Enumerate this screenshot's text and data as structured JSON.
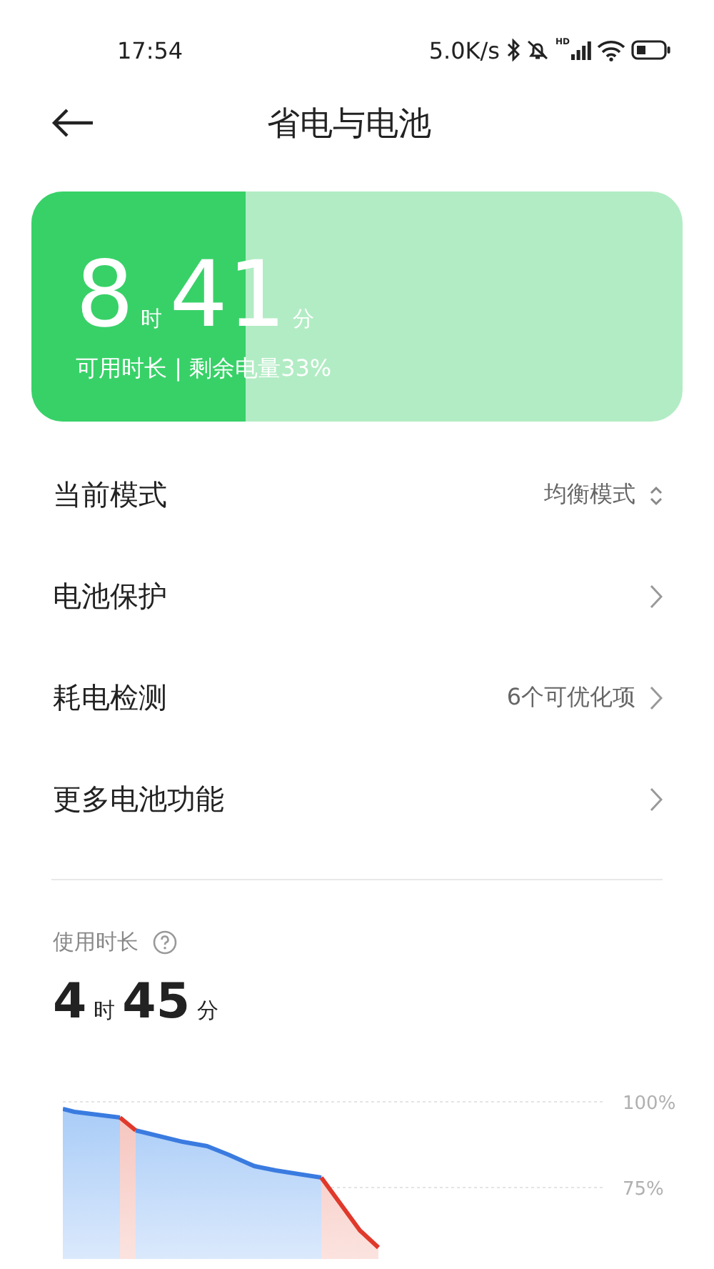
{
  "status_bar": {
    "time": "17:54",
    "speed": "5.0K/s",
    "signal_label": "HD"
  },
  "header": {
    "title": "省电与电池"
  },
  "battery_card": {
    "hours": "8",
    "hours_unit": "时",
    "minutes": "41",
    "minutes_unit": "分",
    "caption": "可用时长 | 剩余电量33%",
    "level": 0.33
  },
  "settings": [
    {
      "kind": "select",
      "label": "当前模式",
      "value": "均衡模式"
    },
    {
      "kind": "link",
      "label": "电池保护"
    },
    {
      "kind": "link",
      "label": "耗电检测",
      "value": "6个可优化项"
    },
    {
      "kind": "link",
      "label": "更多电池功能"
    }
  ],
  "usage": {
    "title": "使用时长",
    "hours": "4",
    "hours_unit": "时",
    "minutes": "45",
    "minutes_unit": "分",
    "chart": {
      "gridline_labels": [
        "100%",
        "75%"
      ]
    }
  }
}
